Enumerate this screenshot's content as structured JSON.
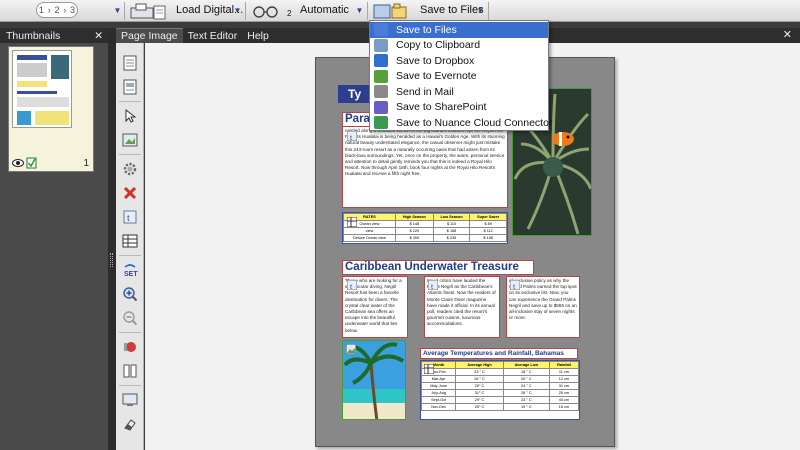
{
  "toolbar": {
    "steps": [
      "1",
      "2",
      "3"
    ],
    "load_label": "Load Digital...",
    "ocr_label": "Automatic",
    "ocr_badge": "2",
    "save_label": "Save to Files"
  },
  "dropdown": {
    "items": [
      {
        "label": "Save to Files",
        "icon": "files-icon",
        "color": "#4a7ed6"
      },
      {
        "label": "Copy to Clipboard",
        "icon": "clipboard-icon",
        "color": "#7a9ac8"
      },
      {
        "label": "Save to Dropbox",
        "icon": "dropbox-icon",
        "color": "#2f6fd0"
      },
      {
        "label": "Save to Evernote",
        "icon": "evernote-icon",
        "color": "#55a13a"
      },
      {
        "label": "Send in Mail",
        "icon": "mail-icon",
        "color": "#8a8a8a"
      },
      {
        "label": "Save to SharePoint",
        "icon": "sharepoint-icon",
        "color": "#6a5ec2"
      },
      {
        "label": "Save to Nuance Cloud Connector",
        "icon": "nuance-cloud-icon",
        "color": "#3a9a52"
      }
    ],
    "selected_index": 0
  },
  "thumbnails": {
    "title": "Thumbnails",
    "page_number": "1"
  },
  "tabs": [
    {
      "label": "Page Image",
      "active": true
    },
    {
      "label": "Text Editor",
      "active": false
    },
    {
      "label": "Help",
      "active": false
    }
  ],
  "document": {
    "title_top": "Ty",
    "title_para": "Para",
    "para1": "nestled along a beautiful stretch of the big island's southern tip, the Royal Hilo Resorts Hualalai is being heralded as a Hawaii's Golden Age. With its stunning natural beauty understated elegance, the casual observer might just mistake this 243-room resort as a naturally occurring oasis that had arisen from its black-lava surroundings. Yet, once on the property, the warm, personal service and attention to detail gently reminds you that this is indeed a Royal Hilo Resort. Now through April 18th, book four nights at the Royal Hilo Resorts Hualalai and receive a fifth night free.",
    "rates_table": {
      "headers": [
        "RATES",
        "High Season",
        "Low Season",
        "Super Saver"
      ],
      "rows": [
        [
          "Ocean view",
          "$ 148",
          "$ 110",
          "$ 89"
        ],
        [
          "view",
          "$ 229",
          "$ 168",
          "$ 112"
        ],
        [
          "Deluxe Ocean view",
          "$ 305",
          "$ 235",
          "$ 198"
        ]
      ]
    },
    "caribbean_title": "Caribbean Underwater Treasure",
    "col1": "Those who are looking for a spectacular diving, Negril Resort has been a favorite destination for divers. The crystal clear water of the Caribbean sea offers an escape into the beautiful underwater world that lies below.",
    "col2": "travel critics have lauded the Palms Negril as the Caribbean's Atlantic finest. Now the readers of Monte Claire Diver magazine have made it official. In its annual poll, readers cited the resort's gourmet cuisine, luxurious accommodations.",
    "col3": "all-inclusive policy as why the Grand Palms earned the top spot on its exclusive list. Now, you can experience the Grand Palms Negril and save up to $555 on an all-inclusive stay of seven nights or more.",
    "temps_title": "Average Temperatures and Rainfall, Bahamas",
    "temps_table": {
      "headers": [
        "Month",
        "Average High",
        "Average Low",
        "Rainfall"
      ],
      "rows": [
        [
          "Jan-Feb",
          "23 ° C",
          "18 ° C",
          "11 cm"
        ],
        [
          "Mar-Apr",
          "26 ° C",
          "20 ° C",
          "12 cm"
        ],
        [
          "May-June",
          "29° C",
          "24 ° C",
          "31 cm"
        ],
        [
          "July-Aug",
          "31° C",
          "26 ° C",
          "25 cm"
        ],
        [
          "Sept-Oct",
          "29° C",
          "23 ° C",
          "43 cm"
        ],
        [
          "Nov-Dec",
          "25° C",
          "19 ° C",
          "16 cm"
        ]
      ]
    }
  }
}
